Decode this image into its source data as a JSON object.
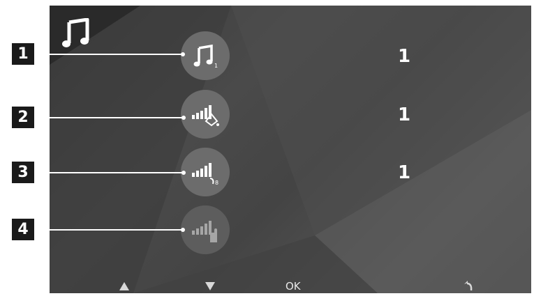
{
  "screen": {
    "header_icon": "music-note-icon"
  },
  "items": [
    {
      "callout": "1",
      "icon": "melody-icon",
      "value": "1"
    },
    {
      "callout": "2",
      "icon": "ring-volume-icon",
      "value": "1"
    },
    {
      "callout": "3",
      "icon": "call-volume-icon",
      "value": "1"
    },
    {
      "callout": "4",
      "icon": "touch-volume-icon",
      "value": ""
    }
  ],
  "footer": {
    "up_icon": "up-arrow-icon",
    "down_icon": "down-arrow-icon",
    "ok_label": "OK",
    "back_icon": "back-arrow-icon"
  }
}
